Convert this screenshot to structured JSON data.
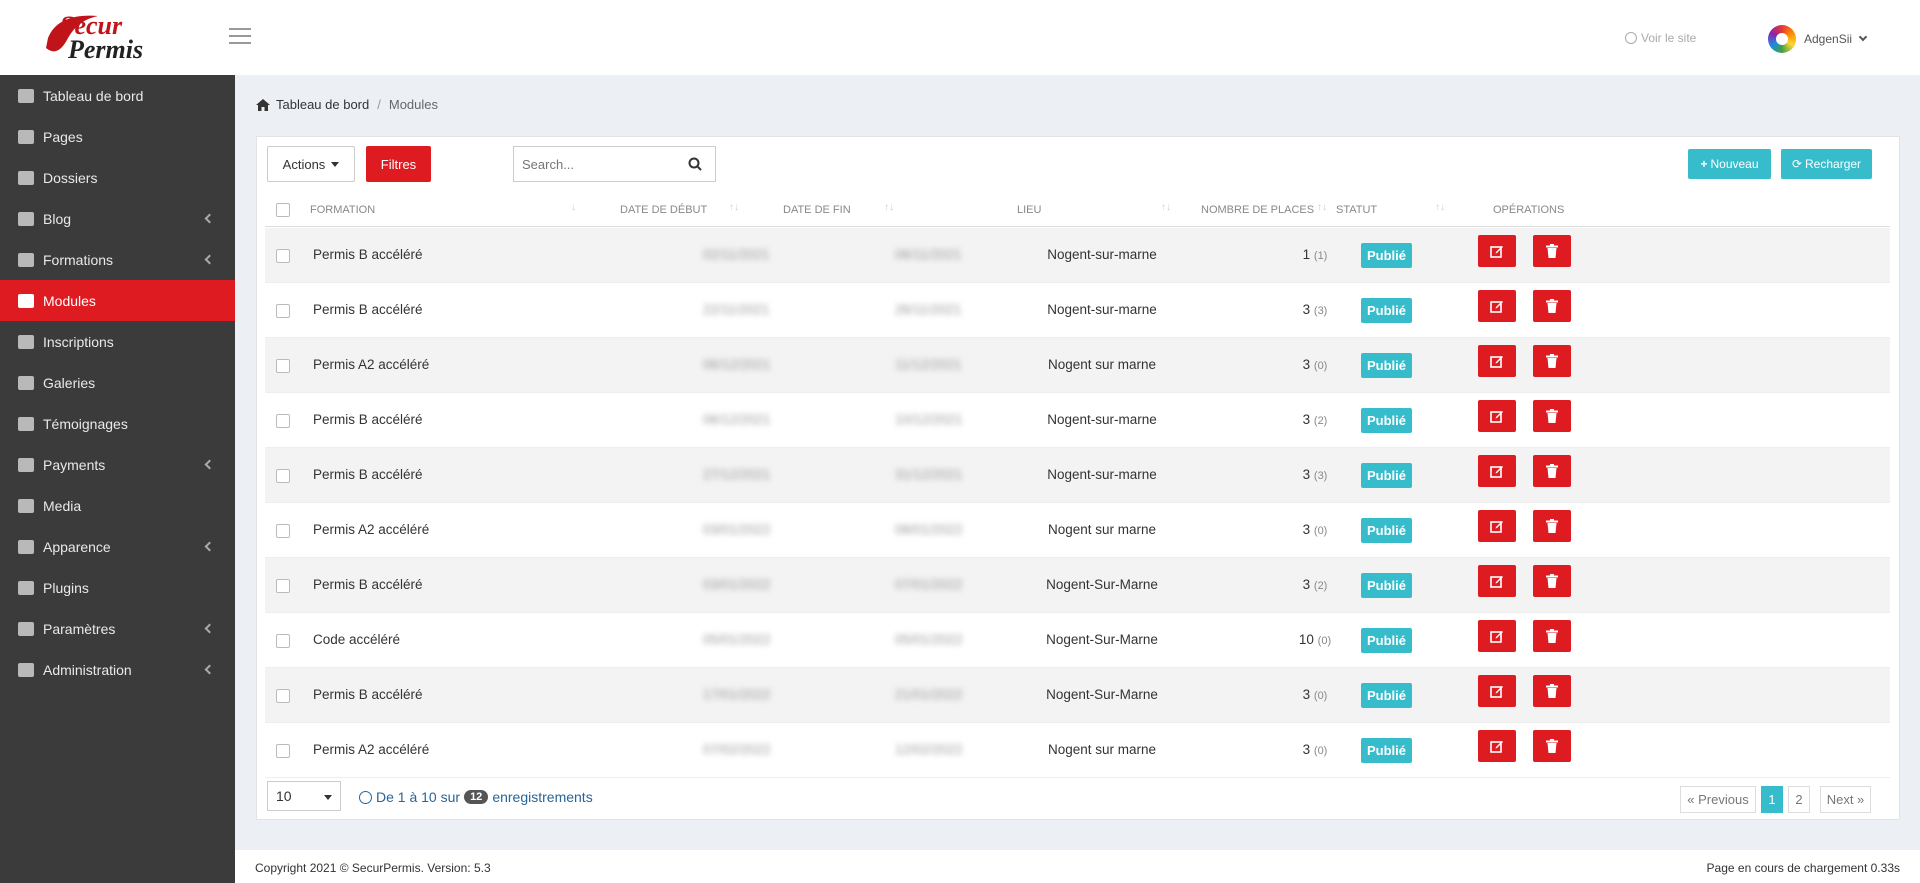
{
  "brand": {
    "logo_text": "SecurPermis"
  },
  "header": {
    "visit_site": "Voir le site",
    "username": "AdgenSii"
  },
  "sidebar": {
    "items": [
      {
        "label": "Tableau de bord",
        "icon": "dashboard-icon",
        "has_children": false,
        "active": false
      },
      {
        "label": "Pages",
        "icon": "pages-icon",
        "has_children": false,
        "active": false
      },
      {
        "label": "Dossiers",
        "icon": "folder-icon",
        "has_children": false,
        "active": false
      },
      {
        "label": "Blog",
        "icon": "edit-icon",
        "has_children": true,
        "active": false
      },
      {
        "label": "Formations",
        "icon": "graduation-cap-icon",
        "has_children": true,
        "active": false
      },
      {
        "label": "Modules",
        "icon": "calendar-icon",
        "has_children": false,
        "active": true
      },
      {
        "label": "Inscriptions",
        "icon": "calendar-check-icon",
        "has_children": false,
        "active": false
      },
      {
        "label": "Galeries",
        "icon": "camera-icon",
        "has_children": false,
        "active": false
      },
      {
        "label": "Témoignages",
        "icon": "comment-icon",
        "has_children": false,
        "active": false
      },
      {
        "label": "Payments",
        "icon": "credit-card-icon",
        "has_children": true,
        "active": false
      },
      {
        "label": "Media",
        "icon": "images-icon",
        "has_children": false,
        "active": false
      },
      {
        "label": "Apparence",
        "icon": "brush-icon",
        "has_children": true,
        "active": false
      },
      {
        "label": "Plugins",
        "icon": "plug-icon",
        "has_children": false,
        "active": false
      },
      {
        "label": "Paramètres",
        "icon": "cogs-icon",
        "has_children": true,
        "active": false
      },
      {
        "label": "Administration",
        "icon": "user-cog-icon",
        "has_children": true,
        "active": false
      }
    ]
  },
  "breadcrumb": {
    "home": "Tableau de bord",
    "current": "Modules"
  },
  "toolbar": {
    "actions": "Actions",
    "filters": "Filtres",
    "search_placeholder": "Search...",
    "new": "Nouveau",
    "reload": "Recharger"
  },
  "table": {
    "headers": {
      "formation": "Formation",
      "date_debut": "Date de début",
      "date_fin": "Date de fin",
      "lieu": "Lieu",
      "places": "Nombre de places",
      "statut": "Statut",
      "operations": "Opérations"
    },
    "rows": [
      {
        "formation": "Permis B accéléré",
        "date_debut": "02/11/2021",
        "date_fin": "06/11/2021",
        "lieu": "Nogent-sur-marne",
        "places": "1",
        "places_sub": "(1)",
        "statut": "Publié"
      },
      {
        "formation": "Permis B accéléré",
        "date_debut": "22/11/2021",
        "date_fin": "26/11/2021",
        "lieu": "Nogent-sur-marne",
        "places": "3",
        "places_sub": "(3)",
        "statut": "Publié"
      },
      {
        "formation": "Permis A2 accéléré",
        "date_debut": "06/12/2021",
        "date_fin": "11/12/2021",
        "lieu": "Nogent sur marne",
        "places": "3",
        "places_sub": "(0)",
        "statut": "Publié"
      },
      {
        "formation": "Permis B accéléré",
        "date_debut": "06/12/2021",
        "date_fin": "10/12/2021",
        "lieu": "Nogent-sur-marne",
        "places": "3",
        "places_sub": "(2)",
        "statut": "Publié"
      },
      {
        "formation": "Permis B accéléré",
        "date_debut": "27/12/2021",
        "date_fin": "31/12/2021",
        "lieu": "Nogent-sur-marne",
        "places": "3",
        "places_sub": "(3)",
        "statut": "Publié"
      },
      {
        "formation": "Permis A2 accéléré",
        "date_debut": "03/01/2022",
        "date_fin": "08/01/2022",
        "lieu": "Nogent sur marne",
        "places": "3",
        "places_sub": "(0)",
        "statut": "Publié"
      },
      {
        "formation": "Permis B accéléré",
        "date_debut": "03/01/2022",
        "date_fin": "07/01/2022",
        "lieu": "Nogent-Sur-Marne",
        "places": "3",
        "places_sub": "(2)",
        "statut": "Publié"
      },
      {
        "formation": "Code accéléré",
        "date_debut": "05/01/2022",
        "date_fin": "05/01/2022",
        "lieu": "Nogent-Sur-Marne",
        "places": "10",
        "places_sub": "(0)",
        "statut": "Publié"
      },
      {
        "formation": "Permis B accéléré",
        "date_debut": "17/01/2022",
        "date_fin": "21/01/2022",
        "lieu": "Nogent-Sur-Marne",
        "places": "3",
        "places_sub": "(0)",
        "statut": "Publié"
      },
      {
        "formation": "Permis A2 accéléré",
        "date_debut": "07/02/2022",
        "date_fin": "12/02/2022",
        "lieu": "Nogent sur marne",
        "places": "3",
        "places_sub": "(0)",
        "statut": "Publié"
      }
    ]
  },
  "pagination": {
    "page_size": "10",
    "info_prefix": "De 1 à 10 sur",
    "total": "12",
    "info_suffix": "enregistrements",
    "previous": "« Previous",
    "pages": [
      "1",
      "2"
    ],
    "current_page": "1",
    "next": "Next »"
  },
  "footer": {
    "copyright": "Copyright 2021 © SecurPermis. Version: 5.3",
    "load_time": "Page en cours de chargement 0.33s"
  },
  "colors": {
    "brand_red": "#dd1b21",
    "accent_teal": "#36bccb",
    "sidebar_bg": "#3b3b3b"
  }
}
